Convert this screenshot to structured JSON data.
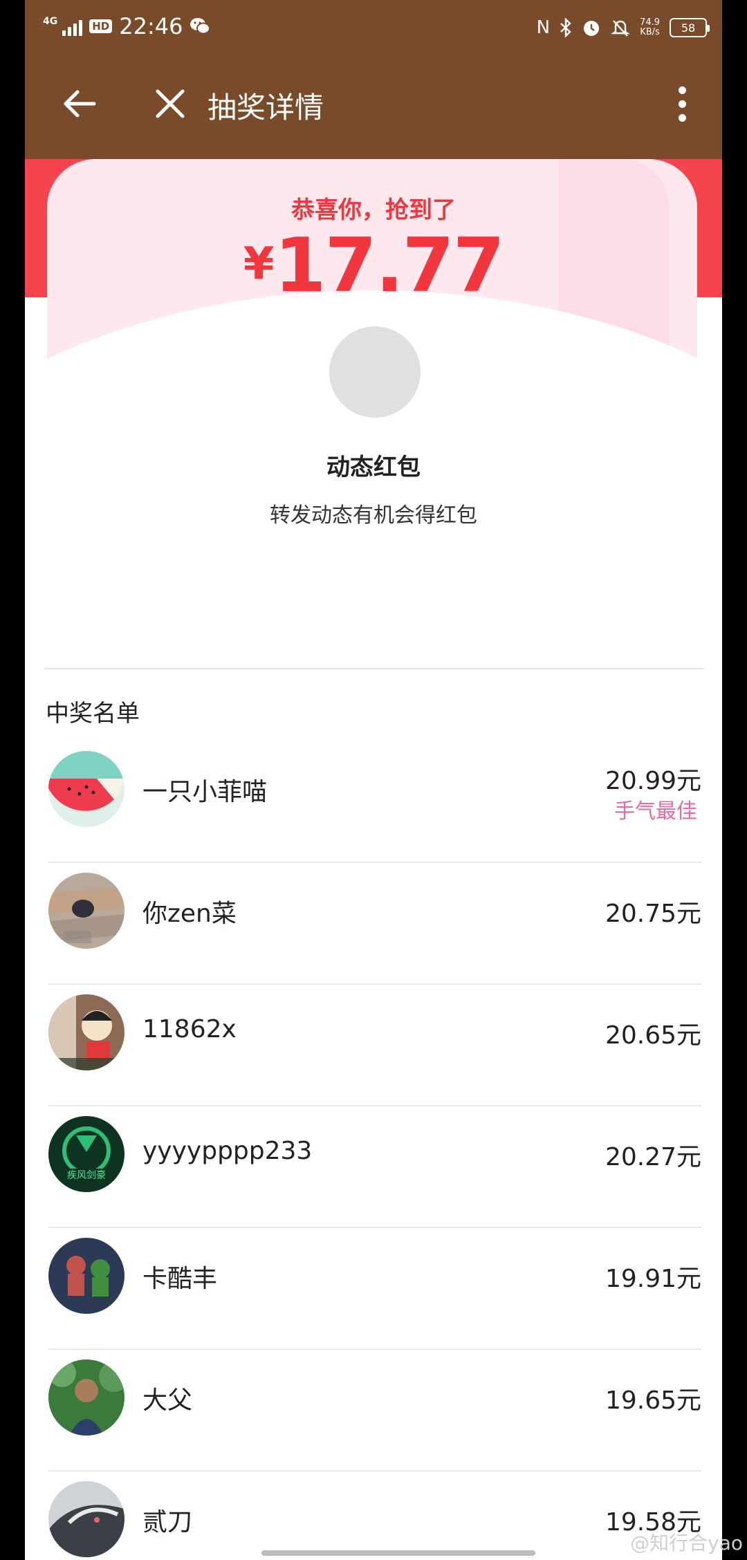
{
  "status_bar": {
    "network": "4G",
    "hd": "HD",
    "time": "22:46",
    "net_speed_value": "74.9",
    "net_speed_unit": "KB/s",
    "battery": "58",
    "icons": [
      "nfc-icon",
      "bluetooth-icon",
      "alarm-icon",
      "mute-icon",
      "wechat-icon"
    ]
  },
  "app_bar": {
    "title": "抽奖详情"
  },
  "header": {
    "congrats": "恭喜你，抢到了",
    "currency": "¥",
    "amount": "17.77",
    "accent_color": "#f1363e"
  },
  "red_packet": {
    "title": "动态红包",
    "subtitle": "转发动态有机会得红包"
  },
  "winners": {
    "title": "中奖名单",
    "items": [
      {
        "name": "一只小菲喵",
        "amount": "20.99元",
        "badge": "手气最佳"
      },
      {
        "name": "你zen菜",
        "amount": "20.75元"
      },
      {
        "name": "11862x",
        "amount": "20.65元"
      },
      {
        "name": "yyyypppp233",
        "amount": "20.27元"
      },
      {
        "name": "卡酷丰",
        "amount": "19.91元"
      },
      {
        "name": "大父",
        "amount": "19.65元"
      },
      {
        "name": "贰刀",
        "amount": "19.58元"
      }
    ]
  },
  "watermark": "@知行合yao"
}
